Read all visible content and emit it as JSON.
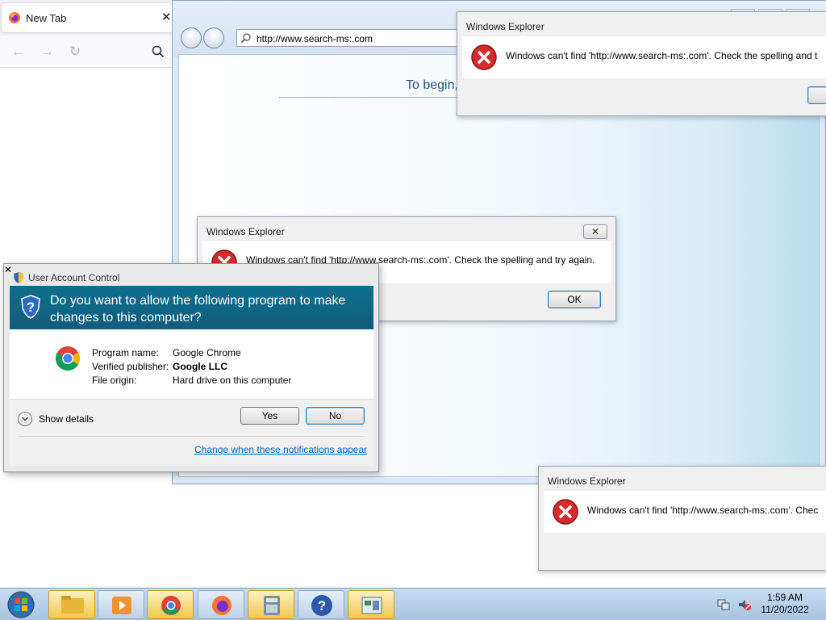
{
  "firefox": {
    "tab_title": "New Tab",
    "tab_close": "✕"
  },
  "ie": {
    "address": "http://www.search-ms:.com",
    "to_begin": "To begin,"
  },
  "explorer_dialogs": [
    {
      "title": "Windows Explorer",
      "message": "Windows can't find 'http://www.search-ms:.com'.  Check the spelling and t"
    },
    {
      "title": "Windows Explorer",
      "message": "Windows can't find 'http://www.search-ms:.com'.  Check the spelling and try again.",
      "ok": "OK"
    },
    {
      "title": "Windows Explorer",
      "message": "Windows can't find 'http://www.search-ms:.com'.  Chec"
    }
  ],
  "uac": {
    "title": "User Account Control",
    "question": "Do you want to allow the following program to make changes to this computer?",
    "program_name_label": "Program name:",
    "program_name": "Google Chrome",
    "publisher_label": "Verified publisher:",
    "publisher": "Google LLC",
    "origin_label": "File origin:",
    "origin": "Hard drive on this computer",
    "show_details": "Show details",
    "yes": "Yes",
    "no": "No",
    "change_link": "Change when these notifications appear"
  },
  "taskbar": {
    "time": "1:59 AM",
    "date": "11/20/2022"
  }
}
